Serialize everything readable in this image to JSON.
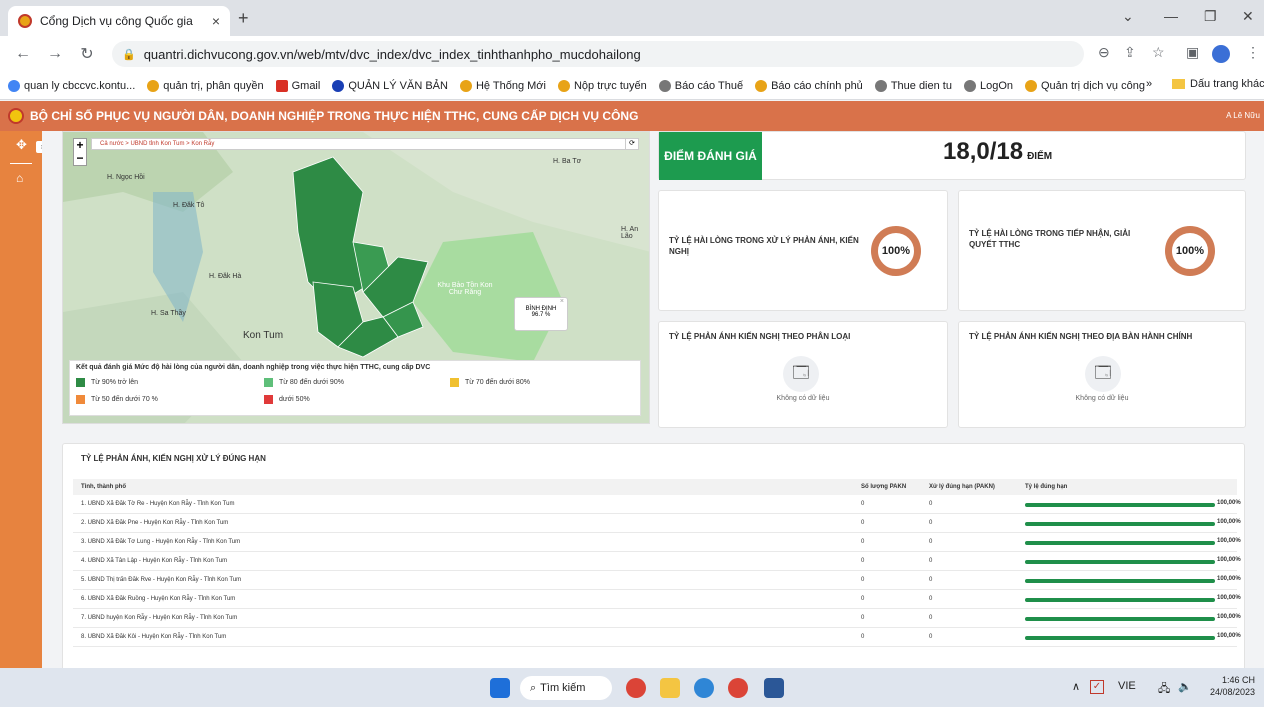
{
  "browser": {
    "tab_title": "Cổng Dịch vụ công Quốc gia",
    "tab_close": "×",
    "new_tab": "+",
    "url": "quantri.dichvucong.gov.vn/web/mtv/dvc_index/dvc_index_tinhthanhpho_mucdohailong",
    "bookmarks": [
      "quan ly cbccvc.kontu...",
      "quản trị, phân quyền",
      "Gmail",
      "QUẢN LÝ VĂN BẢN",
      "Hệ Thống Mới",
      "Nộp trực tuyến",
      "Báo cáo Thuế",
      "Báo cáo chính phủ",
      "Thue dien tu",
      "LogOn",
      "Quản trị dịch vụ công"
    ],
    "bookmarks_more": "»",
    "bookmark_folder": "Dấu trang khác"
  },
  "app": {
    "header_title": "BỘ CHỈ SỐ PHỤC VỤ NGƯỜI DÂN, DOANH NGHIỆP TRONG THỰC HIỆN TTHC, CUNG CẤP DỊCH VỤ CÔNG",
    "user": "A Lê Nữu"
  },
  "map": {
    "breadcrumb": "Cả nước > UBND tỉnh Kon Tum > Kon Rẫy",
    "labels": [
      "H. Ba Tơ",
      "H. Ngọc Hồi",
      "H. Đăk Tô",
      "H. An Lão",
      "H. Đăk Hà",
      "Khu Bảo Tồn Kon Chư Răng",
      "H. Sa Thầy",
      "Kon Tum"
    ],
    "popup_name": "BÌNH ĐỊNH",
    "popup_value": "96.7 %",
    "legend_title": "Kết quả đánh giá Mức độ hài lòng của người dân, doanh nghiệp trong việc thực hiện TTHC, cung cấp DVC",
    "legend": [
      {
        "label": "Từ 90% trở lên",
        "color": "#2e8b45"
      },
      {
        "label": "Từ 80 đến dưới 90%",
        "color": "#5fbf7a"
      },
      {
        "label": "Từ 70 đến dưới 80%",
        "color": "#f0c030"
      },
      {
        "label": "Từ 50 đến dưới 70 %",
        "color": "#f08a3a"
      },
      {
        "label": "dưới 50%",
        "color": "#e03a3a"
      }
    ]
  },
  "score": {
    "label": "ĐIỂM ĐÁNH GIÁ",
    "value": "18,0/18",
    "unit": "ĐIỂM"
  },
  "satisfaction": [
    {
      "title": "TỶ LỆ HÀI LÒNG TRONG XỬ LÝ PHẢN ÁNH, KIẾN NGHỊ",
      "value": "100%"
    },
    {
      "title": "TỶ LỆ HÀI LÒNG TRONG TIẾP NHẬN, GIẢI QUYẾT TTHC",
      "value": "100%"
    }
  ],
  "empty_cards": [
    {
      "title": "TỶ LỆ PHẢN ÁNH KIẾN NGHỊ THEO PHÂN LOẠI",
      "empty": "Không có dữ liệu"
    },
    {
      "title": "TỶ LỆ PHẢN ÁNH KIẾN NGHỊ THEO ĐỊA BÀN HÀNH CHÍNH",
      "empty": "Không có dữ liệu"
    }
  ],
  "table": {
    "title": "TỶ LỆ PHẢN ÁNH, KIẾN NGHỊ XỬ LÝ ĐÚNG HẠN",
    "headers": [
      "Tỉnh, thành phố",
      "Số lượng PAKN",
      "Xử lý đúng hạn (PAKN)",
      "Tỷ lệ đúng hạn"
    ],
    "rows": [
      {
        "name": "1. UBND Xã Đăk Tờ Re - Huyện Kon Rẫy - Tỉnh Kon Tum",
        "count": "0",
        "ontime": "0",
        "rate": "100,00%"
      },
      {
        "name": "2. UBND Xã Đăk Pne - Huyện Kon Rẫy - Tỉnh Kon Tum",
        "count": "0",
        "ontime": "0",
        "rate": "100,00%"
      },
      {
        "name": "3. UBND Xã Đăk Tơ Lung - Huyện Kon Rẫy - Tỉnh Kon Tum",
        "count": "0",
        "ontime": "0",
        "rate": "100,00%"
      },
      {
        "name": "4. UBND Xã Tân Lập - Huyện Kon Rẫy - Tỉnh Kon Tum",
        "count": "0",
        "ontime": "0",
        "rate": "100,00%"
      },
      {
        "name": "5. UBND Thị trấn Đăk Rve - Huyện Kon Rẫy - Tỉnh Kon Tum",
        "count": "0",
        "ontime": "0",
        "rate": "100,00%"
      },
      {
        "name": "6. UBND Xã Đăk Ruồng - Huyện Kon Rẫy - Tỉnh Kon Tum",
        "count": "0",
        "ontime": "0",
        "rate": "100,00%"
      },
      {
        "name": "7. UBND huyện Kon Rẫy - Huyện Kon Rẫy - Tỉnh Kon Tum",
        "count": "0",
        "ontime": "0",
        "rate": "100,00%"
      },
      {
        "name": "8. UBND Xã Đăk Kôi - Huyện Kon Rẫy - Tỉnh Kon Tum",
        "count": "0",
        "ontime": "0",
        "rate": "100,00%"
      }
    ]
  },
  "taskbar": {
    "search": "Tìm kiếm",
    "lang": "VIE",
    "time": "1:46 CH",
    "date": "24/08/2023"
  }
}
